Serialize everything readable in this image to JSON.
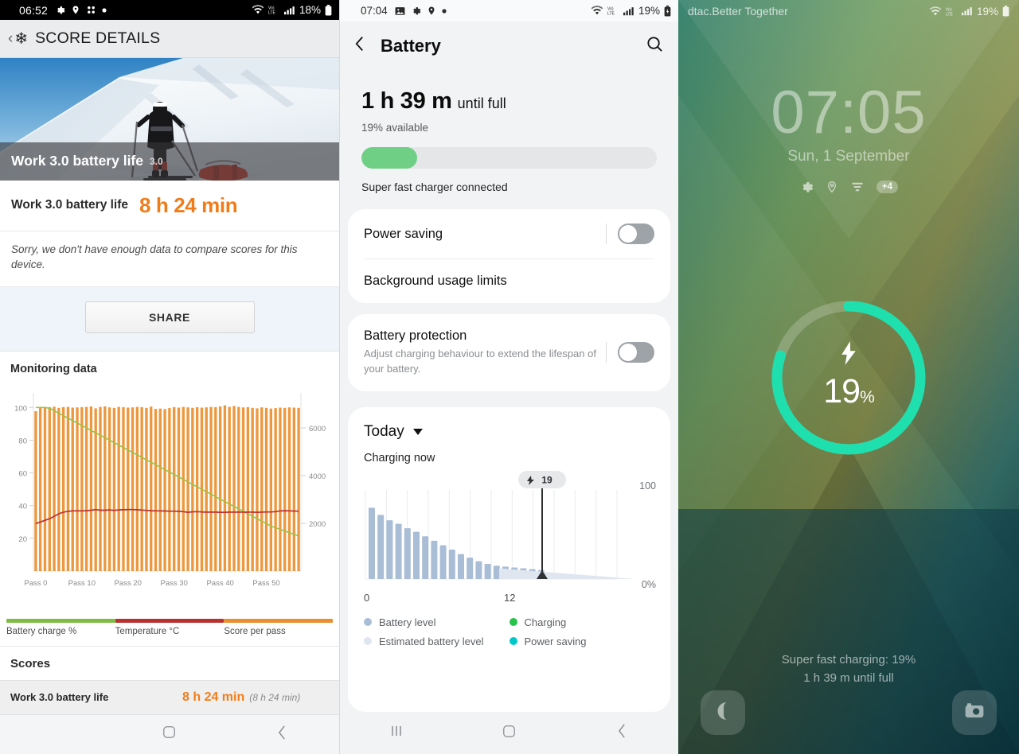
{
  "panel1": {
    "status_bar": {
      "time": "06:52",
      "battery": "18%",
      "network": "LTE",
      "icons": [
        "gear-icon",
        "location-icon",
        "apps-icon",
        "dot-icon"
      ]
    },
    "header": {
      "back": "‹",
      "icon": "snowflake-icon",
      "title": "SCORE DETAILS"
    },
    "hero": {
      "caption": "Work 3.0 battery life",
      "version": "3.0"
    },
    "score": {
      "label": "Work 3.0 battery life",
      "value": "8 h 24 min"
    },
    "note": "Sorry, we don't have enough data to compare scores for this device.",
    "share_label": "SHARE",
    "monitoring_title": "Monitoring data",
    "scores_title": "Scores",
    "score_line": {
      "name": "Work 3.0 battery life",
      "value": "8 h 24 min",
      "paren": "(8 h 24 min)"
    },
    "navbar": [
      "home-icon",
      "back-icon"
    ]
  },
  "chart_data": [
    {
      "type": "bar",
      "title": "Monitoring data",
      "xlabel": "",
      "ylabel": "Battery charge %",
      "ylim": [
        0,
        105
      ],
      "y2lim": [
        0,
        7200
      ],
      "y2label": "Score per pass",
      "grid": true,
      "legend_position": "bottom",
      "xticks": [
        "Pass 0",
        "Pass 10",
        "Pass 20",
        "Pass 30",
        "Pass 40",
        "Pass 50"
      ],
      "yticks": [
        20,
        40,
        60,
        80,
        100
      ],
      "y2ticks": [
        2000,
        4000,
        6000
      ],
      "legend": [
        {
          "name": "Battery charge %",
          "color": "#7fbc43"
        },
        {
          "name": "Temperature °C",
          "color": "#b8312f"
        },
        {
          "name": "Score per pass",
          "color": "#eb8f2e"
        }
      ],
      "series": [
        {
          "name": "Score per pass",
          "type": "bar",
          "color": "#eb8f2e",
          "axis": "right",
          "values": [
            6700,
            6850,
            6880,
            6870,
            6890,
            6840,
            6870,
            6880,
            6850,
            6860,
            6870,
            6880,
            6900,
            6820,
            6880,
            6900,
            6860,
            6840,
            6880,
            6870,
            6850,
            6860,
            6880,
            6870,
            6840,
            6890,
            6800,
            6810,
            6790,
            6830,
            6870,
            6850,
            6880,
            6860,
            6840,
            6870,
            6850,
            6860,
            6880,
            6870,
            6900,
            6950,
            6880,
            6920,
            6880,
            6860,
            6870,
            6840,
            6820,
            6860,
            6840,
            6810,
            6830,
            6850,
            6840,
            6860,
            6850,
            6840
          ]
        },
        {
          "name": "Battery charge %",
          "type": "line",
          "color": "#9ec24a",
          "axis": "left",
          "values": [
            100,
            100,
            100,
            99.5,
            98,
            96.5,
            95,
            93.5,
            92,
            90.5,
            89,
            87.5,
            86,
            84.5,
            83,
            81.5,
            80,
            78.5,
            77,
            75.5,
            74,
            72.5,
            71,
            69.5,
            68,
            66.5,
            65,
            63.5,
            62,
            60.5,
            59,
            57.5,
            56,
            54.5,
            53,
            51.5,
            50,
            48.5,
            47,
            45.5,
            44,
            42.5,
            41,
            39.5,
            38,
            36.5,
            35,
            33.5,
            32,
            30.5,
            29,
            27.5,
            26.5,
            25.5,
            24.5,
            23.5,
            22.5,
            21.5
          ]
        },
        {
          "name": "Temperature °C",
          "type": "line",
          "color": "#b8312f",
          "axis": "left",
          "values": [
            29,
            30,
            31,
            32,
            33.5,
            35,
            36,
            36.5,
            36.8,
            36.8,
            36.8,
            36.9,
            37.2,
            37.6,
            37.2,
            37.2,
            37.4,
            37.1,
            37.4,
            37.5,
            37.6,
            37.6,
            37.5,
            37.3,
            37.1,
            36.9,
            36.8,
            36.8,
            36.7,
            36.6,
            36.6,
            36.5,
            36.3,
            35.9,
            36.2,
            36.3,
            36.1,
            36.0,
            36.0,
            36.0,
            35.9,
            35.9,
            36.0,
            36.0,
            36.0,
            36.0,
            36.0,
            36.0,
            35.9,
            36.0,
            36.1,
            36.1,
            36.3,
            36.8,
            36.9,
            36.8,
            36.7,
            36.6
          ]
        }
      ]
    },
    {
      "type": "bar",
      "title": "Today",
      "ylim": [
        0,
        100
      ],
      "ymax_label": "100",
      "ymin_label": "0%",
      "xticks": [
        "0",
        "12"
      ],
      "marker_label": "19",
      "legend": [
        {
          "name": "Battery level",
          "color": "#a9bdd6"
        },
        {
          "name": "Estimated battery level",
          "color": "#dfe6ef"
        },
        {
          "name": "Charging",
          "color": "#26c24a"
        },
        {
          "name": "Power saving",
          "color": "#00c8c8"
        }
      ],
      "series": [
        {
          "name": "Battery level",
          "color": "#a9bdd6",
          "values": [
            80,
            72,
            66,
            62,
            57,
            53,
            48,
            43,
            38,
            33,
            28,
            24,
            20,
            17,
            15,
            14,
            13,
            12,
            11,
            10
          ]
        },
        {
          "name": "Estimated battery level",
          "color": "#dfe6ef",
          "values": [
            10,
            8.5,
            7,
            5.5,
            4,
            2.5,
            1.5,
            0.8,
            0,
            0,
            0,
            0,
            0,
            0,
            0,
            0,
            0,
            0,
            0,
            0
          ]
        }
      ]
    }
  ],
  "panel2": {
    "status_bar": {
      "time": "07:04",
      "battery": "19%",
      "network": "LTE",
      "icons": [
        "image-icon",
        "gear-icon",
        "location-icon",
        "dot-icon"
      ]
    },
    "appbar": {
      "back": "back-icon",
      "title": "Battery",
      "search": "search-icon"
    },
    "summary": {
      "time_big": "1 h 39 m",
      "time_small": "until full",
      "available": "19% available",
      "progress_pct": 19,
      "charger": "Super fast charger connected"
    },
    "rows": [
      {
        "title": "Power saving",
        "sub": "",
        "toggle": "off"
      },
      {
        "title": "Background usage limits",
        "sub": "",
        "toggle": "none"
      },
      {
        "title": "Battery protection",
        "sub": "Adjust charging behaviour to extend the lifespan of your battery.",
        "toggle": "off"
      }
    ],
    "today": {
      "label": "Today",
      "status": "Charging now",
      "y_top": "100",
      "y_bottom": "0%",
      "x_left": "0",
      "x_mid": "12",
      "marker": "19"
    },
    "legend": [
      {
        "label": "Battery level",
        "color": "#a9bdd6"
      },
      {
        "label": "Charging",
        "color": "#26c24a"
      },
      {
        "label": "Estimated battery level",
        "color": "#dfe6ef"
      },
      {
        "label": "Power saving",
        "color": "#00c8c8"
      }
    ],
    "navbar": [
      "recents-icon",
      "home-icon",
      "back-icon"
    ]
  },
  "panel3": {
    "status_bar": {
      "carrier": "dtac.Better Together",
      "battery": "19%",
      "network": "LTE"
    },
    "clock": "07:05",
    "date": "Sun, 1 September",
    "icons": [
      "gear-icon",
      "location-icon",
      "filter-icon"
    ],
    "more_badge": "+4",
    "ring": {
      "percent": 19,
      "percent_label": "19",
      "percent_unit": "%",
      "bolt": "bolt-icon",
      "color": "#1fdfae",
      "track_color": "rgba(255,255,255,0.22)"
    },
    "charging_line1": "Super fast charging: 19%",
    "charging_line2": "1 h 39 m until full",
    "shortcuts": [
      "phone-icon",
      "camera-icon"
    ]
  },
  "colors": {
    "accent_orange": "#f07d1a",
    "green": "#6fcf85",
    "teal": "#1fdfae",
    "bar_orange": "#eb8f2e"
  }
}
